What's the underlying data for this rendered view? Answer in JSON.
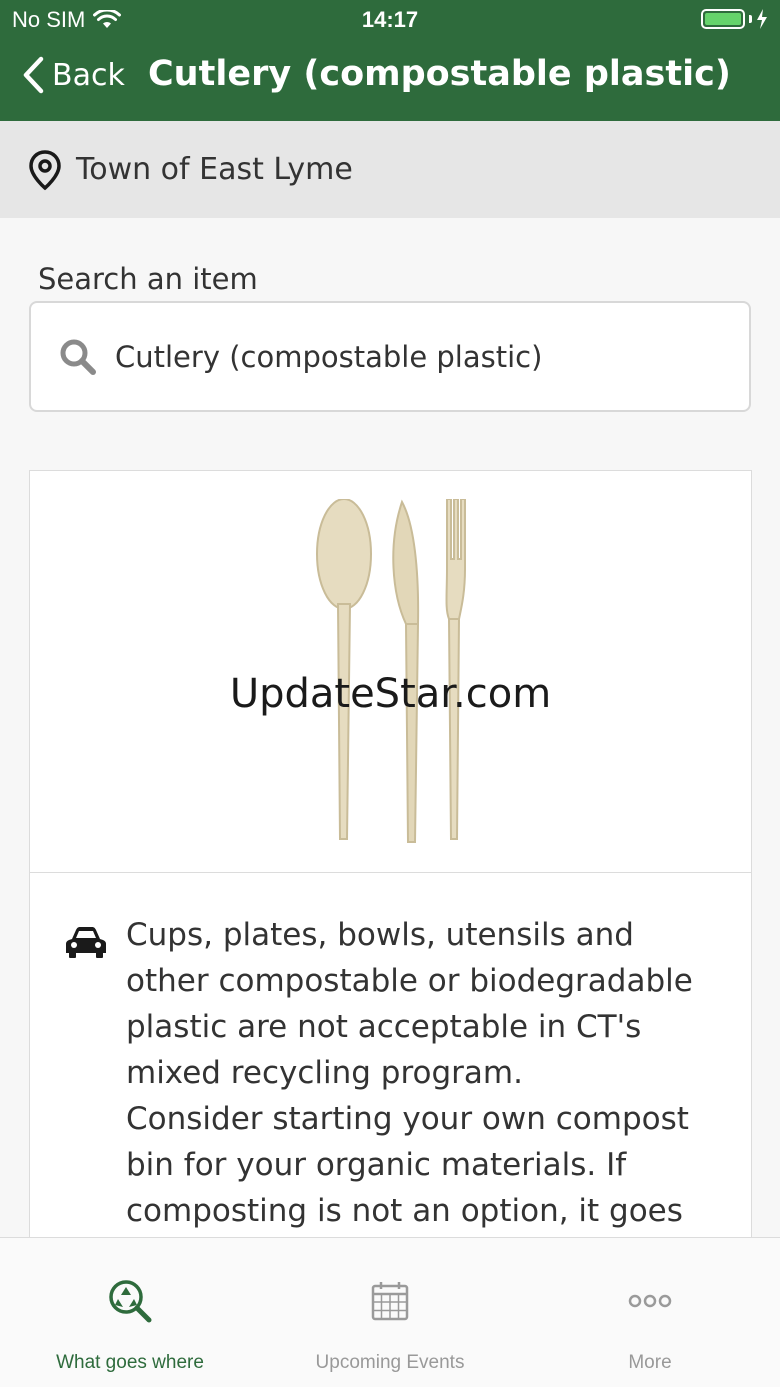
{
  "status_bar": {
    "carrier": "No SIM",
    "time": "14:17"
  },
  "nav": {
    "back_label": "Back",
    "title": "Cutlery (compostable plastic)"
  },
  "location": {
    "name": "Town of East Lyme"
  },
  "search": {
    "label": "Search an item",
    "value": "Cutlery (compostable plastic)"
  },
  "item": {
    "watermark": "UpdateStar.com",
    "description_1": "Cups, plates, bowls, utensils and other compostable or biodegradable plastic are not acceptable in CT's mixed recycling program.",
    "description_2": "Consider starting your own compost bin for your organic materials. If composting is not an option, it goes"
  },
  "tabs": [
    {
      "label": "What goes where",
      "icon": "recycle-search-icon",
      "active": true
    },
    {
      "label": "Upcoming Events",
      "icon": "calendar-icon",
      "active": false
    },
    {
      "label": "More",
      "icon": "more-dots-icon",
      "active": false
    }
  ],
  "colors": {
    "brand": "#2e6b3c",
    "battery": "#65d36b"
  }
}
